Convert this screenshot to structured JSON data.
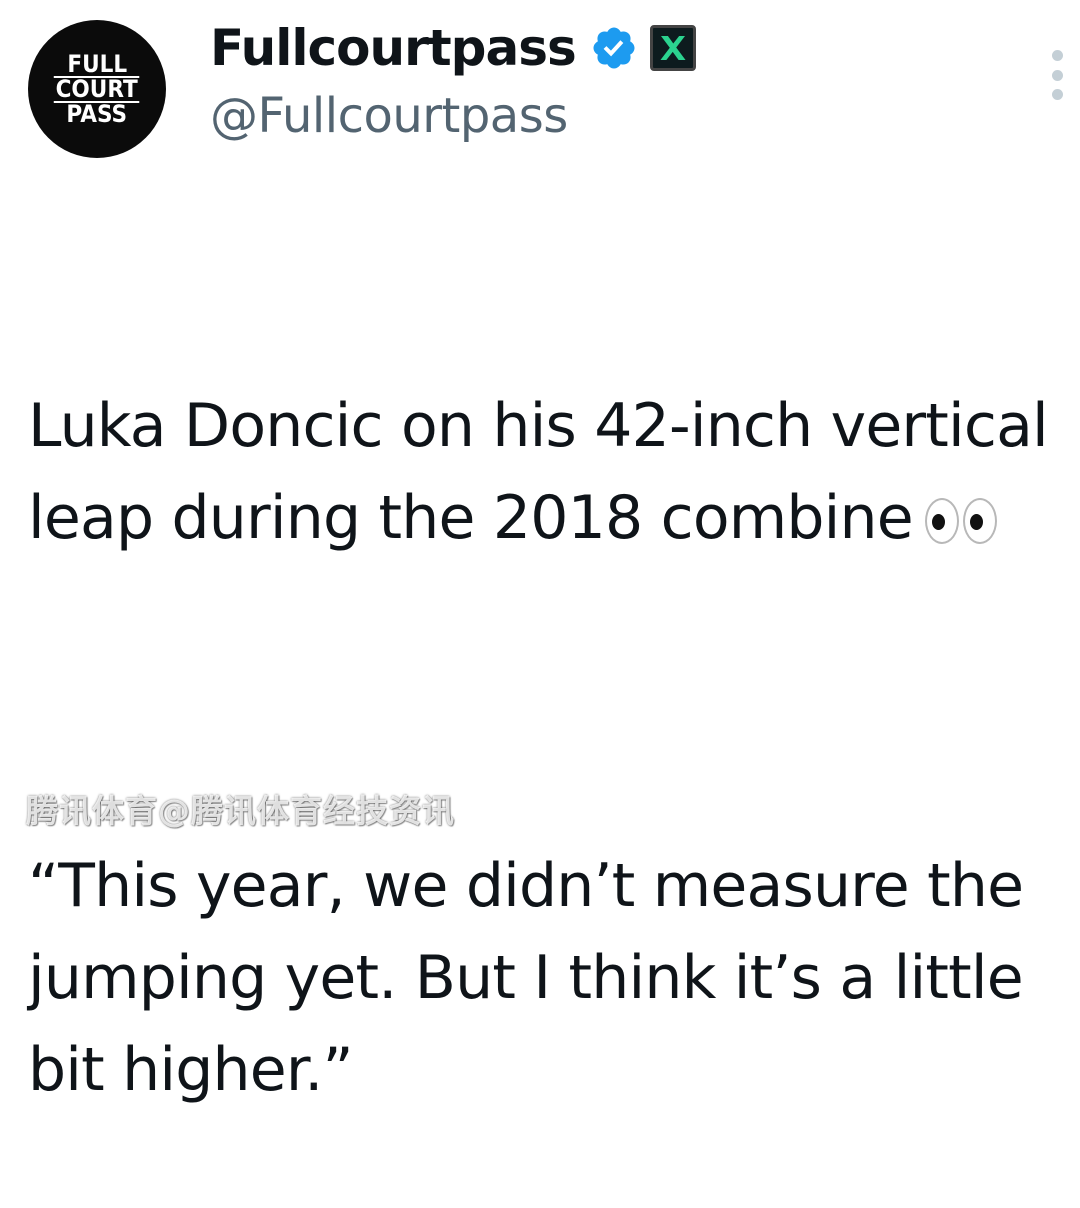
{
  "profile": {
    "avatar_lines": [
      "FULL",
      "COURT",
      "PASS"
    ],
    "display_name": "Fullcourtpass",
    "handle": "@Fullcourtpass",
    "verified_icon": "verified-badge-icon",
    "affiliate_icon": "x-badge-icon",
    "accent_color": "#1d9bf0"
  },
  "tweet": {
    "paragraph1": "Luka Doncic on his 42-inch vertical leap during the 2018 combine",
    "emoji": "👀",
    "paragraph2": "“This year, we didn’t measure the jumping yet. But I think it’s a little bit higher.”"
  },
  "more_menu_icon": "more-vertical-icon",
  "watermark": "腾讯体育@腾讯体育经技资讯"
}
